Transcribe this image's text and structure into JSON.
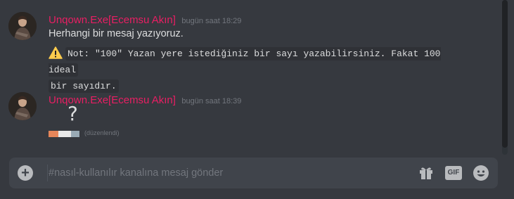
{
  "messages": [
    {
      "username": "Unqown.Exe[Ecemsu Akın]",
      "timestamp": "bugün saat 18:29",
      "text": "Herhangi bir mesaj yazıyoruz.",
      "note_line1": "Not: \"100\" Yazan yere istediğiniz bir sayı yazabilirsiniz. Fakat 100 ideal",
      "note_line2": "bir sayıdır."
    },
    {
      "username": "Unqown.Exe[Ecemsu Akın]",
      "timestamp": "bugün saat 18:39",
      "glyph": "?",
      "edited_label": "(düzenlendi)"
    }
  ],
  "composer": {
    "placeholder": "#nasıl-kullanılır kanalına mesaj gönder",
    "add_label": "+",
    "gif_label": "GIF"
  },
  "colors": {
    "background": "#36393f",
    "username": "#e91e63",
    "composer": "#40444b"
  }
}
